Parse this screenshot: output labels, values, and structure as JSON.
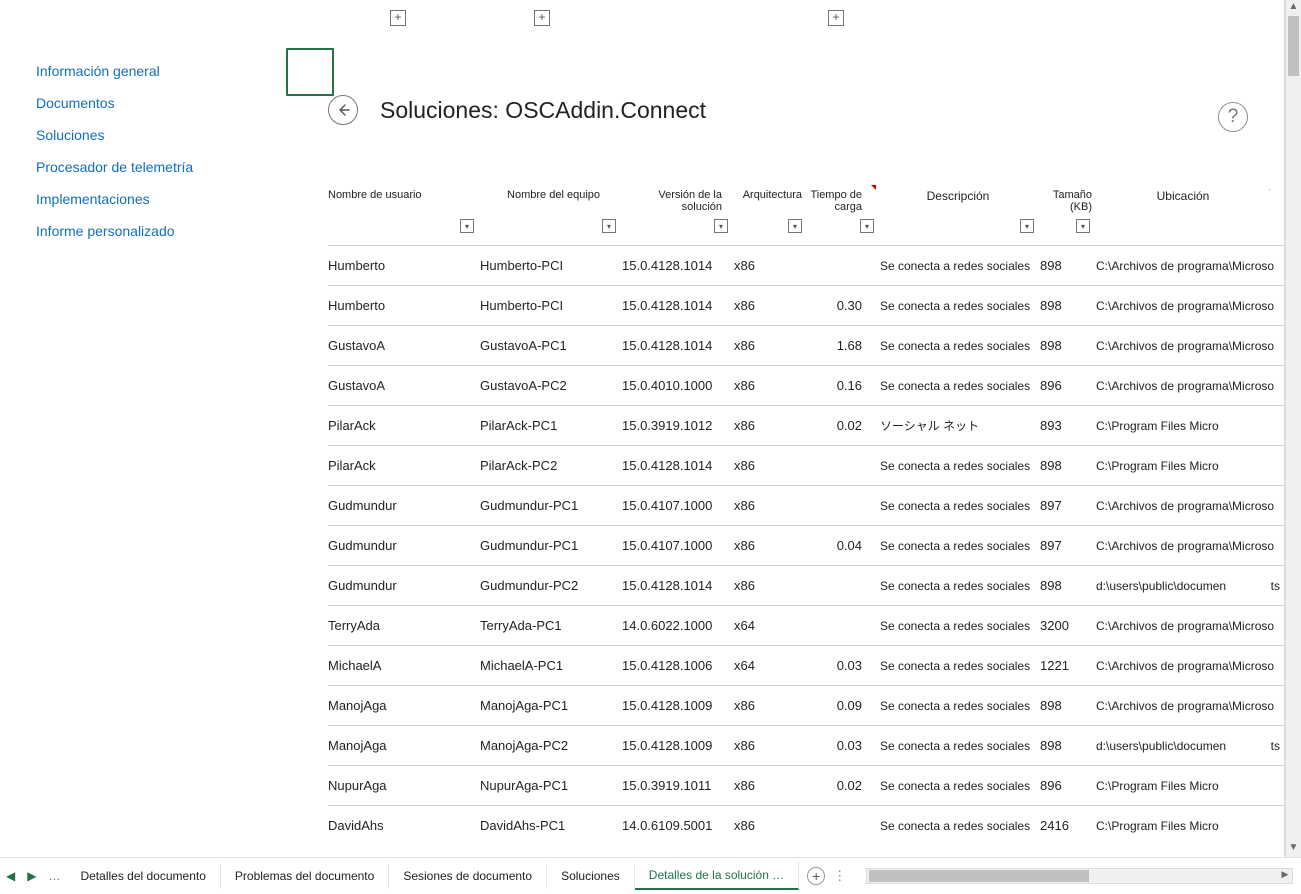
{
  "sidebar": {
    "items": [
      {
        "label": "Información general"
      },
      {
        "label": "Documentos"
      },
      {
        "label": "Soluciones"
      },
      {
        "label": "Procesador de telemetría"
      },
      {
        "label": "Implementaciones"
      },
      {
        "label": "Informe personalizado"
      }
    ]
  },
  "page": {
    "title": "Soluciones: OSCAddin.Connect"
  },
  "columns": {
    "user": "Nombre de usuario",
    "computer": "Nombre del equipo",
    "version": "Versión de la solución",
    "arch": "Arquitectura",
    "load": "Tiempo de carga",
    "desc": "Descripción",
    "size": "Tamaño (KB)",
    "loc": "Ubicación"
  },
  "rows": [
    {
      "user": "Humberto",
      "comp": "Humberto-PCI",
      "ver": "15.0.4128.1014",
      "arch": "x86",
      "load": "",
      "desc": "Se conecta a redes sociales",
      "size": "898",
      "loc": "C:\\Archivos de programa\\Microsoft",
      "extra": ""
    },
    {
      "user": "Humberto",
      "comp": "Humberto-PCI",
      "ver": "15.0.4128.1014",
      "arch": "x86",
      "load": "0.30",
      "desc": "Se conecta a redes sociales",
      "size": "898",
      "loc": "C:\\Archivos de programa\\Microsoft",
      "extra": ""
    },
    {
      "user": "GustavoA",
      "comp": "GustavoA-PC1",
      "ver": "15.0.4128.1014",
      "arch": "x86",
      "load": "1.68",
      "desc": "Se conecta a redes sociales",
      "size": "898",
      "loc": "C:\\Archivos de programa\\Microsoft",
      "extra": ""
    },
    {
      "user": "GustavoA",
      "comp": "GustavoA-PC2",
      "ver": "15.0.4010.1000",
      "arch": "x86",
      "load": "0.16",
      "desc": "Se conecta a redes sociales",
      "size": "896",
      "loc": "C:\\Archivos de programa\\Microsoft",
      "extra": ""
    },
    {
      "user": "PilarAck",
      "comp": "PilarAck-PC1",
      "ver": "15.0.3919.1012",
      "arch": "x86",
      "load": "0.02",
      "desc": "ソーシャル ネット",
      "size": "893",
      "loc": "C:\\Program Files Micro",
      "extra": ""
    },
    {
      "user": "PilarAck",
      "comp": "PilarAck-PC2",
      "ver": "15.0.4128.1014",
      "arch": "x86",
      "load": "",
      "desc": "Se conecta a redes sociales",
      "size": "898",
      "loc": "C:\\Program Files Micro",
      "extra": ""
    },
    {
      "user": "Gudmundur",
      "comp": "Gudmundur-PC1",
      "ver": "15.0.4107.1000",
      "arch": "x86",
      "load": "",
      "desc": "Se conecta a redes sociales",
      "size": "897",
      "loc": "C:\\Archivos de programa\\Microsoft",
      "extra": ""
    },
    {
      "user": "Gudmundur",
      "comp": "Gudmundur-PC1",
      "ver": "15.0.4107.1000",
      "arch": "x86",
      "load": "0.04",
      "desc": "Se conecta a redes sociales",
      "size": "897",
      "loc": "C:\\Archivos de programa\\Microsoft",
      "extra": ""
    },
    {
      "user": "Gudmundur",
      "comp": "Gudmundur-PC2",
      "ver": "15.0.4128.1014",
      "arch": "x86",
      "load": "",
      "desc": "Se conecta a redes sociales",
      "size": "898",
      "loc": "d:\\users\\public\\documen",
      "extra": "ts"
    },
    {
      "user": "TerryAda",
      "comp": "TerryAda-PC1",
      "ver": "14.0.6022.1000",
      "arch": "x64",
      "load": "",
      "desc": "Se conecta a redes sociales",
      "size": "3200",
      "loc": "C:\\Archivos de programa\\Microsoft",
      "extra": ""
    },
    {
      "user": "MichaelA",
      "comp": "MichaelA-PC1",
      "ver": "15.0.4128.1006",
      "arch": "x64",
      "load": "0.03",
      "desc": "Se conecta a redes sociales",
      "size": "1221",
      "loc": "C:\\Archivos de programa\\Microsoft",
      "extra": ""
    },
    {
      "user": "ManojAga",
      "comp": "ManojAga-PC1",
      "ver": "15.0.4128.1009",
      "arch": "x86",
      "load": "0.09",
      "desc": "Se conecta a redes sociales",
      "size": "898",
      "loc": "C:\\Archivos de programa\\Microsoft",
      "extra": ""
    },
    {
      "user": "ManojAga",
      "comp": "ManojAga-PC2",
      "ver": "15.0.4128.1009",
      "arch": "x86",
      "load": "0.03",
      "desc": "Se conecta a redes sociales",
      "size": "898",
      "loc": "d:\\users\\public\\documen",
      "extra": "ts"
    },
    {
      "user": "NupurAga",
      "comp": "NupurAga-PC1",
      "ver": "15.0.3919.1011",
      "arch": "x86",
      "load": "0.02",
      "desc": "Se conecta a redes sociales",
      "size": "896",
      "loc": "C:\\Program Files Micro",
      "extra": ""
    },
    {
      "user": "DavidAhs",
      "comp": "DavidAhs-PC1",
      "ver": "14.0.6109.5001",
      "arch": "x86",
      "load": "",
      "desc": "Se conecta a redes sociales",
      "size": "2416",
      "loc": "C:\\Program Files Micro",
      "extra": ""
    }
  ],
  "tabs": {
    "items": [
      {
        "label": "Detalles del documento"
      },
      {
        "label": "Problemas del documento"
      },
      {
        "label": "Sesiones de documento"
      },
      {
        "label": "Soluciones"
      },
      {
        "label": "Detalles de la solución …"
      }
    ],
    "nav_dots": "…"
  }
}
